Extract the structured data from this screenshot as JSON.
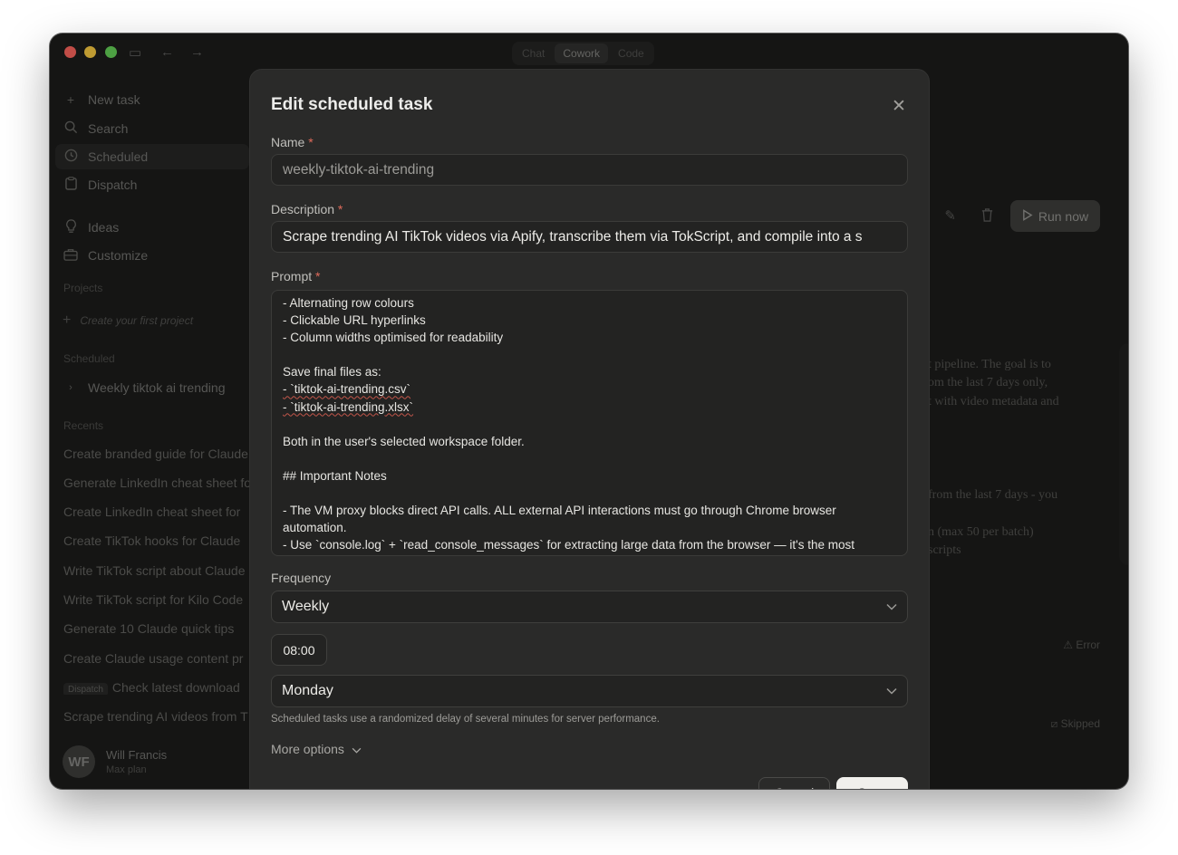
{
  "titlebar": {
    "modes": [
      {
        "label": "Chat",
        "active": false
      },
      {
        "label": "Cowork",
        "active": true
      },
      {
        "label": "Code",
        "active": false
      }
    ]
  },
  "sidebar": {
    "nav": [
      {
        "label": "New task",
        "icon": "plus-icon"
      },
      {
        "label": "Search",
        "icon": "search-icon"
      },
      {
        "label": "Scheduled",
        "icon": "clock-icon",
        "active": true
      },
      {
        "label": "Dispatch",
        "icon": "clipboard-icon"
      },
      {
        "label": "Ideas",
        "icon": "lightbulb-icon"
      },
      {
        "label": "Customize",
        "icon": "briefcase-icon"
      }
    ],
    "projects_heading": "Projects",
    "create_project": "Create your first project",
    "scheduled_heading": "Scheduled",
    "scheduled_items": [
      "Weekly tiktok ai trending"
    ],
    "recents_heading": "Recents",
    "recents": [
      "Create branded guide for Claude",
      "Generate LinkedIn cheat sheet for",
      "Create LinkedIn cheat sheet for",
      "Create TikTok hooks for Claude",
      "Write TikTok script about Claude",
      "Write TikTok script for Kilo Code",
      "Generate 10 Claude quick tips",
      "Create Claude usage content pr",
      "Check latest download",
      "Scrape trending AI videos from T"
    ],
    "dispatch_tag": "Dispatch",
    "user": {
      "initials": "WF",
      "name": "Will Francis",
      "plan": "Max plan"
    }
  },
  "background": {
    "run_now": "Run now",
    "card_lines": [
      "t pipeline. The goal is to",
      "om the last 7 days only,",
      "t with video metadata and",
      "from the last 7 days - you",
      "n (max 50 per batch)",
      "scripts"
    ],
    "status_error": "Error",
    "status_skipped": "Skipped"
  },
  "modal": {
    "title": "Edit scheduled task",
    "name_label": "Name",
    "name_value": "weekly-tiktok-ai-trending",
    "description_label": "Description",
    "description_value": "Scrape trending AI TikTok videos via Apify, transcribe them via TokScript, and compile into a s",
    "prompt_label": "Prompt",
    "prompt_lines": [
      "- Alternating row colours",
      "- Clickable URL hyperlinks",
      "- Column widths optimised for readability",
      "",
      "Save final files as:",
      "- `tiktok-ai-trending.csv`",
      "- `tiktok-ai-trending.xlsx`",
      "",
      "Both in the user's selected workspace folder.",
      "",
      "## Important Notes",
      "",
      "- The VM proxy blocks direct API calls. ALL external API interactions must go through Chrome browser",
      "automation.",
      "- Use `console.log` + `read_console_messages` for extracting large data from the browser — it's the most"
    ],
    "frequency_label": "Frequency",
    "frequency_value": "Weekly",
    "time_value": "08:00",
    "day_value": "Monday",
    "hint": "Scheduled tasks use a randomized delay of several minutes for server performance.",
    "more_options": "More options",
    "cancel_label": "Cancel",
    "save_label": "Save"
  }
}
